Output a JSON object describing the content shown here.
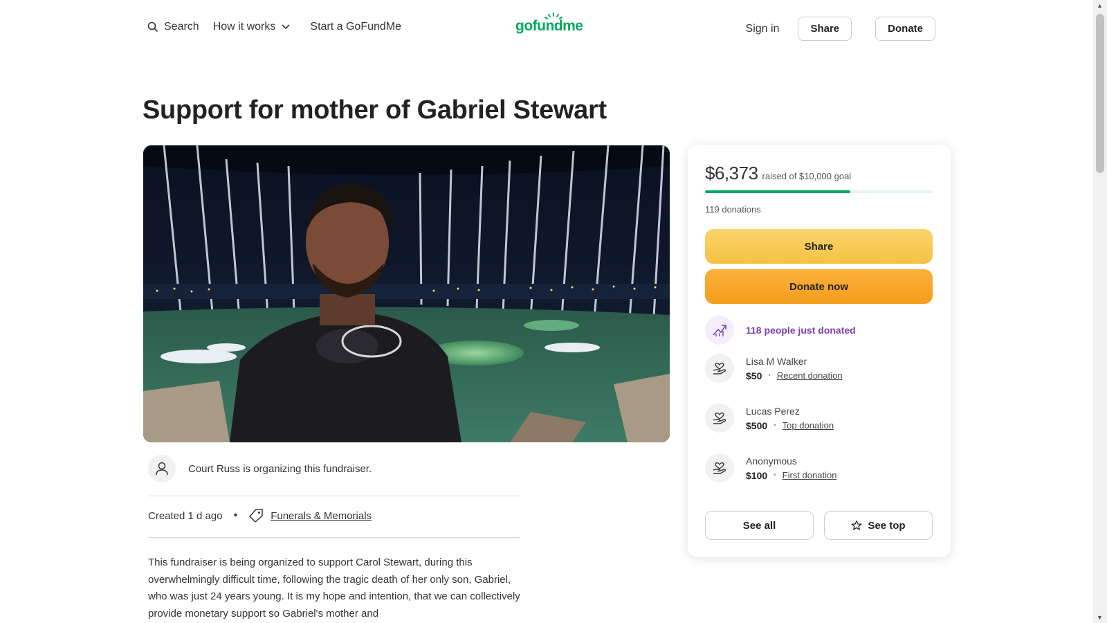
{
  "header": {
    "search_label": "Search",
    "how_label": "How it works",
    "start_label": "Start a GoFundMe",
    "logo_text": "gofundme",
    "signin_label": "Sign in",
    "share_label": "Share",
    "donate_label": "Donate"
  },
  "page": {
    "title": "Support for mother of Gabriel Stewart"
  },
  "organizer": {
    "text": "Court Russ is organizing this fundraiser.",
    "created": "Created 1 d ago",
    "category": "Funerals & Memorials"
  },
  "description": "This fundraiser is being organized to support Carol Stewart, during this overwhelmingly difficult time, following the tragic death of her only son, Gabriel, who was just 24 years young. It is my hope and intention, that we can collectively provide monetary support so Gabriel's mother and",
  "donation_card": {
    "raised": "$6,373",
    "goal_text": "raised of $10,000 goal",
    "progress_fraction": 0.637,
    "donations_count": "119 donations",
    "share_label": "Share",
    "donate_now_label": "Donate now",
    "trend_text": "118 people just donated",
    "donors": [
      {
        "name": "Lisa M Walker",
        "amount": "$50",
        "tag": "Recent donation"
      },
      {
        "name": "Lucas Perez",
        "amount": "$500",
        "tag": "Top donation"
      },
      {
        "name": "Anonymous",
        "amount": "$100",
        "tag": "First donation"
      }
    ],
    "see_all_label": "See all",
    "see_top_label": "See top"
  },
  "colors": {
    "brand_green": "#02a95c",
    "share_yellow": "#f4c244",
    "donate_orange": "#f59e1c",
    "trend_purple": "#7a3fb0"
  }
}
